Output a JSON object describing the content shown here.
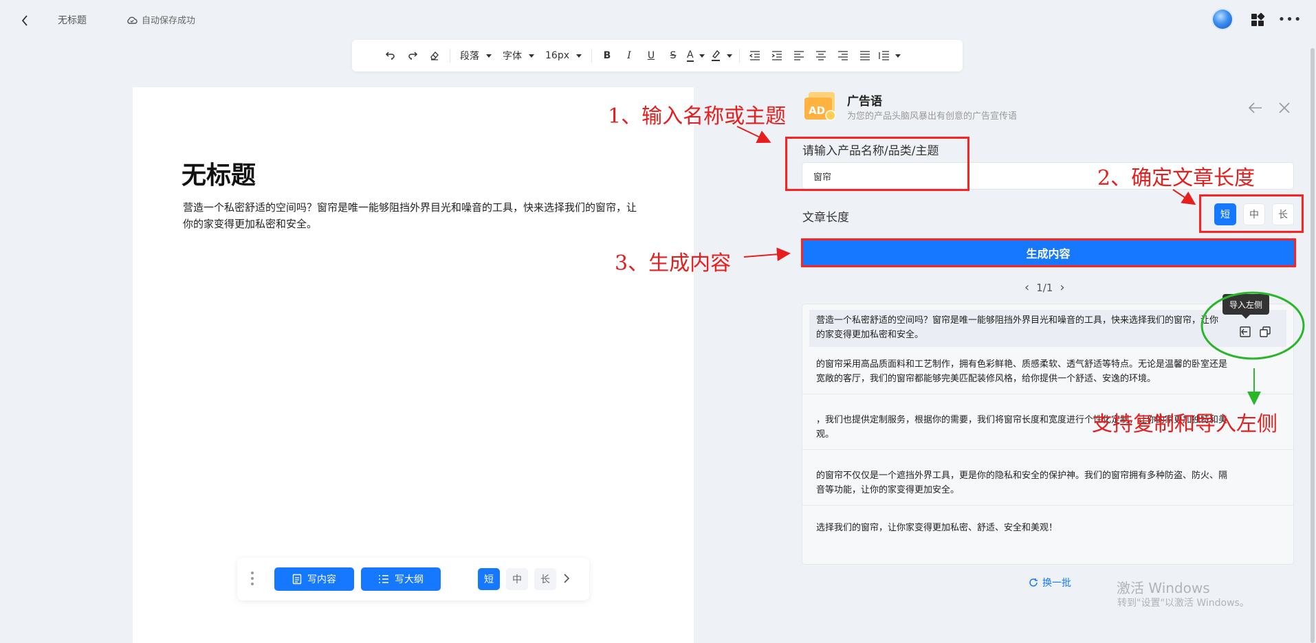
{
  "topbar": {
    "doc_name": "无标题",
    "autosave_text": "自动保存成功"
  },
  "toolbar": {
    "paragraph_label": "段落",
    "font_label": "字体",
    "size_label": "16px",
    "bold_label": "B",
    "italic_label": "I",
    "underline_label": "U",
    "strike_label": "S",
    "font_color_label": "A"
  },
  "editor": {
    "title": "无标题",
    "body": "营造一个私密舒适的空间吗？窗帘是唯一能够阻挡外界目光和噪音的工具，快来选择我们的窗帘，让你的家变得更加私密和安全。"
  },
  "floatbar": {
    "write_content": "写内容",
    "write_outline": "写大纲",
    "len_short": "短",
    "len_mid": "中",
    "len_long": "长"
  },
  "panel": {
    "logo_text": "AD",
    "title": "广告语",
    "subtitle": "为您的产品头脑风暴出有创意的广告宣传语",
    "input_label": "请输入产品名称/品类/主题",
    "input_value": "窗帘",
    "length_label": "文章长度",
    "len_short": "短",
    "len_mid": "中",
    "len_long": "长",
    "generate_button": "生成内容",
    "pager": "1/1",
    "tooltip": "导入左侧",
    "results": [
      "营造一个私密舒适的空间吗？窗帘是唯一能够阻挡外界目光和噪音的工具，快来选择我们的窗帘，让你的家变得更加私密和安全。",
      "的窗帘采用高品质面料和工艺制作，拥有色彩鲜艳、质感柔软、透气舒适等特点。无论是温馨的卧室还是宽敞的客厅，我们的窗帘都能够完美匹配装修风格，给你提供一个舒适、安逸的环境。",
      "，我们也提供定制服务，根据你的需要，我们将窗帘长度和宽度进行个性化定制，让你的家更加独特和美观。",
      "的窗帘不仅仅是一个遮挡外界工具，更是你的隐私和安全的保护神。我们的窗帘拥有多种防盗、防火、隔音等功能，让你的家变得更加安全。",
      "选择我们的窗帘，让你家变得更加私密、舒适、安全和美观！"
    ],
    "refresh_label": "换一批"
  },
  "watermark": {
    "line1": "激活 Windows",
    "line2": "转到\"设置\"以激活 Windows。"
  },
  "annotations": {
    "step1": "1、输入名称或主题",
    "step2": "2、确定文章长度",
    "step3": "3、生成内容",
    "note": "支持复制和导入左侧"
  },
  "colors": {
    "accent": "#1677ff",
    "annotation_red": "#ff2020",
    "annotation_green": "#2bb52b"
  }
}
